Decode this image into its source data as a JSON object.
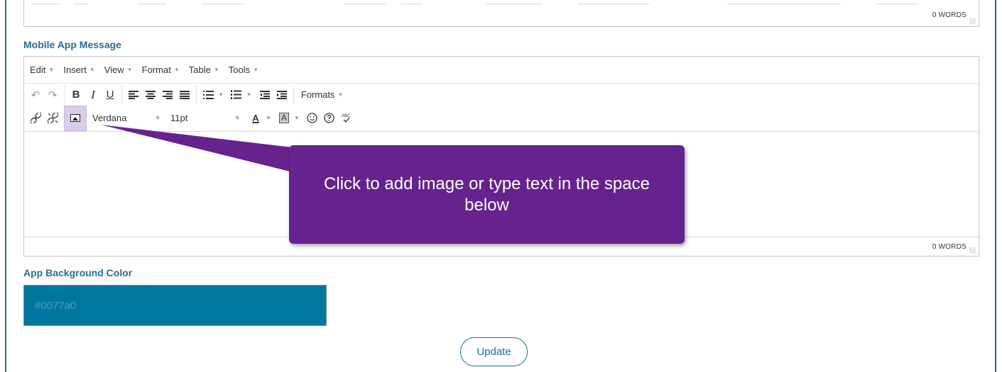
{
  "top_editor": {
    "word_count": "0 WORDS"
  },
  "mobile_message": {
    "label": "Mobile App Message",
    "menu": [
      {
        "label": "Edit"
      },
      {
        "label": "Insert"
      },
      {
        "label": "View"
      },
      {
        "label": "Format"
      },
      {
        "label": "Table"
      },
      {
        "label": "Tools"
      }
    ],
    "toolbar": {
      "undo_icon": "undo-icon",
      "redo_icon": "redo-icon",
      "bold": "B",
      "italic": "I",
      "underline": "U",
      "formats_label": "Formats",
      "font_family": "Verdana",
      "font_size": "11pt",
      "text_color_glyph": "A",
      "bg_color_glyph": "A",
      "spellcheck_glyph": "ABC"
    },
    "word_count": "0 WORDS"
  },
  "callout": {
    "text": "Click to add image or type text in the space below",
    "color": "#66228d"
  },
  "app_background": {
    "label": "App Background Color",
    "value": "#0077a0",
    "swatch_color": "#0077a0"
  },
  "update_button": {
    "label": "Update"
  },
  "accent_color": "#1d6f94"
}
